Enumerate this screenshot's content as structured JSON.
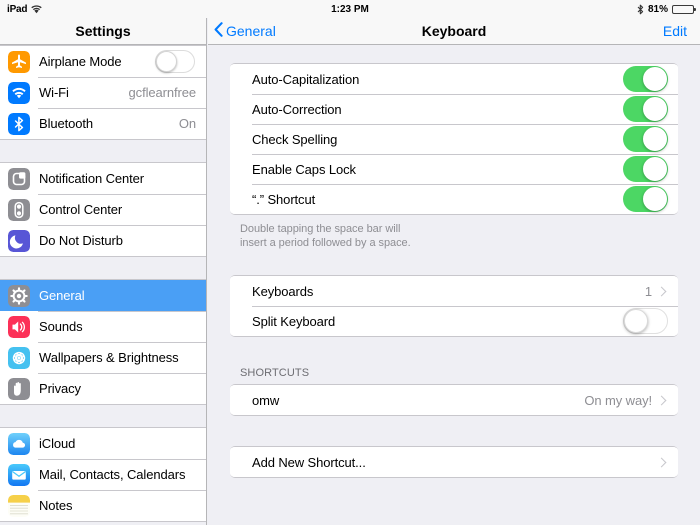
{
  "status_bar": {
    "device": "iPad",
    "wifi_icon": "wifi-icon",
    "time": "1:23 PM",
    "bluetooth_icon": "bluetooth-icon",
    "battery_percent": "81%",
    "battery_level": 81
  },
  "sidebar": {
    "title": "Settings",
    "groups": [
      {
        "items": [
          {
            "label": "Airplane Mode",
            "icon": "airplane-icon",
            "icon_color": "#f90",
            "accessory": "switch",
            "switch_on": false
          },
          {
            "label": "Wi-Fi",
            "icon": "wifi-icon",
            "icon_color": "#007aff",
            "accessory": "value",
            "value": "gcflearnfree"
          },
          {
            "label": "Bluetooth",
            "icon": "bluetooth-icon",
            "icon_color": "#007aff",
            "accessory": "value",
            "value": "On"
          }
        ]
      },
      {
        "items": [
          {
            "label": "Notification Center",
            "icon": "notification-center-icon",
            "icon_color": "#8e8e93",
            "accessory": "none"
          },
          {
            "label": "Control Center",
            "icon": "control-center-icon",
            "icon_color": "#8e8e93",
            "accessory": "none"
          },
          {
            "label": "Do Not Disturb",
            "icon": "do-not-disturb-icon",
            "icon_color": "#5856d6",
            "accessory": "none"
          }
        ]
      },
      {
        "items": [
          {
            "label": "General",
            "icon": "gear-icon",
            "icon_color": "#8e8e93",
            "accessory": "none",
            "selected": true
          },
          {
            "label": "Sounds",
            "icon": "sounds-icon",
            "icon_color": "#fc3158",
            "accessory": "none"
          },
          {
            "label": "Wallpapers & Brightness",
            "icon": "wallpapers-icon",
            "icon_color": "#45c1f0",
            "accessory": "none"
          },
          {
            "label": "Privacy",
            "icon": "privacy-hand-icon",
            "icon_color": "#8e8e93",
            "accessory": "none"
          }
        ]
      },
      {
        "items": [
          {
            "label": "iCloud",
            "icon": "icloud-icon",
            "icon_color": "#3badf4",
            "accessory": "none"
          },
          {
            "label": "Mail, Contacts, Calendars",
            "icon": "mail-icon",
            "icon_color": "#1d9bf8",
            "accessory": "none"
          },
          {
            "label": "Notes",
            "icon": "notes-icon",
            "icon_color": "#f6d049",
            "accessory": "none"
          }
        ]
      }
    ]
  },
  "content": {
    "back_label": "General",
    "title": "Keyboard",
    "edit_label": "Edit",
    "toggles": [
      {
        "label": "Auto-Capitalization",
        "on": true
      },
      {
        "label": "Auto-Correction",
        "on": true
      },
      {
        "label": "Check Spelling",
        "on": true
      },
      {
        "label": "Enable Caps Lock",
        "on": true
      },
      {
        "label": "“.” Shortcut",
        "on": true
      }
    ],
    "footnote_line1": "Double tapping the space bar will",
    "footnote_line2": "insert a period followed by a space.",
    "keyboards_label": "Keyboards",
    "keyboards_value": "1",
    "split_keyboard_label": "Split Keyboard",
    "split_keyboard_on": false,
    "shortcuts_header": "SHORTCUTS",
    "shortcut_name": "omw",
    "shortcut_phrase": "On my way!",
    "add_shortcut_label": "Add New Shortcut..."
  },
  "colors": {
    "accent_blue": "#007aff",
    "selection_blue": "#4a9ff5",
    "switch_green": "#4cd764",
    "group_bg": "#efeff4"
  }
}
